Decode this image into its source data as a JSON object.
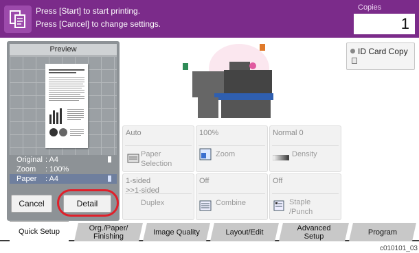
{
  "header": {
    "message_line1": "Press [Start] to start printing.",
    "message_line2": "Press [Cancel] to change settings.",
    "copies_label": "Copies",
    "copies_value": "1",
    "bg_color": "#7b2b8a"
  },
  "preview": {
    "title": "Preview",
    "original_label": "Original",
    "original_value": ": A4",
    "zoom_label": "Zoom",
    "zoom_value": ": 100%",
    "paper_label": "Paper",
    "paper_value": ": A4",
    "cancel_label": "Cancel",
    "detail_label": "Detail",
    "highlight_color": "#e0202a"
  },
  "id_card": {
    "label": "ID Card Copy"
  },
  "functions": {
    "paper": {
      "value": "Auto",
      "label_line1": "Paper",
      "label_line2": "Selection"
    },
    "zoom": {
      "value": "100%",
      "label": "Zoom"
    },
    "density": {
      "value": "Normal 0",
      "label": "Density"
    },
    "duplex": {
      "value_line1": "1-sided",
      "value_line2": ">>1-sided",
      "label": "Duplex"
    },
    "combine": {
      "value": "Off",
      "label": "Combine"
    },
    "staple": {
      "value": "Off",
      "label_line1": "Staple",
      "label_line2": "/Punch"
    }
  },
  "tabs": {
    "quick_setup": "Quick Setup",
    "org_line1": "Org./Paper/",
    "org_line2": "Finishing",
    "image_quality": "Image Quality",
    "layout_edit": "Layout/Edit",
    "advanced_line1": "Advanced",
    "advanced_line2": "Setup",
    "program": "Program"
  },
  "footer_code": "c010101_03"
}
